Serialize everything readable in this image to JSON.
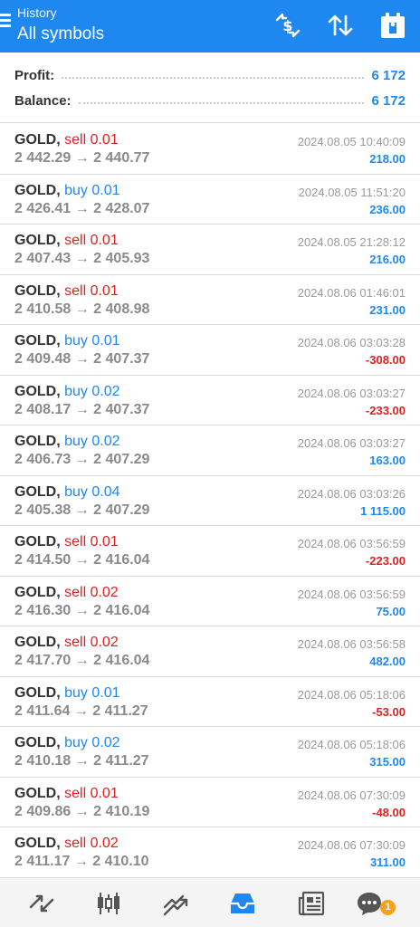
{
  "header": {
    "subtitle": "History",
    "title": "All symbols",
    "bg_color": "#1e88f0"
  },
  "summary": {
    "profit_label": "Profit:",
    "profit_value": "6 172",
    "balance_label": "Balance:",
    "balance_value": "6 172"
  },
  "deals": [
    {
      "symbol": "GOLD,",
      "type": "sell 0.01",
      "side": "sell",
      "prices": "2 442.29 → 2 440.77",
      "time": "2024.08.05 10:40:09",
      "profit": "218.00",
      "sign": "pos"
    },
    {
      "symbol": "GOLD,",
      "type": "buy 0.01",
      "side": "buy",
      "prices": "2 426.41 → 2 428.07",
      "time": "2024.08.05 11:51:20",
      "profit": "236.00",
      "sign": "pos"
    },
    {
      "symbol": "GOLD,",
      "type": "sell 0.01",
      "side": "sell",
      "prices": "2 407.43 → 2 405.93",
      "time": "2024.08.05 21:28:12",
      "profit": "216.00",
      "sign": "pos"
    },
    {
      "symbol": "GOLD,",
      "type": "sell 0.01",
      "side": "sell",
      "prices": "2 410.58 → 2 408.98",
      "time": "2024.08.06 01:46:01",
      "profit": "231.00",
      "sign": "pos"
    },
    {
      "symbol": "GOLD,",
      "type": "buy 0.01",
      "side": "buy",
      "prices": "2 409.48 → 2 407.37",
      "time": "2024.08.06 03:03:28",
      "profit": "-308.00",
      "sign": "neg"
    },
    {
      "symbol": "GOLD,",
      "type": "buy 0.02",
      "side": "buy",
      "prices": "2 408.17 → 2 407.37",
      "time": "2024.08.06 03:03:27",
      "profit": "-233.00",
      "sign": "neg"
    },
    {
      "symbol": "GOLD,",
      "type": "buy 0.02",
      "side": "buy",
      "prices": "2 406.73 → 2 407.29",
      "time": "2024.08.06 03:03:27",
      "profit": "163.00",
      "sign": "pos"
    },
    {
      "symbol": "GOLD,",
      "type": "buy 0.04",
      "side": "buy",
      "prices": "2 405.38 → 2 407.29",
      "time": "2024.08.06 03:03:26",
      "profit": "1 115.00",
      "sign": "pos"
    },
    {
      "symbol": "GOLD,",
      "type": "sell 0.01",
      "side": "sell",
      "prices": "2 414.50 → 2 416.04",
      "time": "2024.08.06 03:56:59",
      "profit": "-223.00",
      "sign": "neg"
    },
    {
      "symbol": "GOLD,",
      "type": "sell 0.02",
      "side": "sell",
      "prices": "2 416.30 → 2 416.04",
      "time": "2024.08.06 03:56:59",
      "profit": "75.00",
      "sign": "pos"
    },
    {
      "symbol": "GOLD,",
      "type": "sell 0.02",
      "side": "sell",
      "prices": "2 417.70 → 2 416.04",
      "time": "2024.08.06 03:56:58",
      "profit": "482.00",
      "sign": "pos"
    },
    {
      "symbol": "GOLD,",
      "type": "buy 0.01",
      "side": "buy",
      "prices": "2 411.64 → 2 411.27",
      "time": "2024.08.06 05:18:06",
      "profit": "-53.00",
      "sign": "neg"
    },
    {
      "symbol": "GOLD,",
      "type": "buy 0.02",
      "side": "buy",
      "prices": "2 410.18 → 2 411.27",
      "time": "2024.08.06 05:18:06",
      "profit": "315.00",
      "sign": "pos"
    },
    {
      "symbol": "GOLD,",
      "type": "sell 0.01",
      "side": "sell",
      "prices": "2 409.86 → 2 410.19",
      "time": "2024.08.06 07:30:09",
      "profit": "-48.00",
      "sign": "neg"
    },
    {
      "symbol": "GOLD,",
      "type": "sell 0.02",
      "side": "sell",
      "prices": "2 411.17 → 2 410.10",
      "time": "2024.08.06 07:30:09",
      "profit": "311.00",
      "sign": "pos"
    }
  ],
  "bottom_nav": {
    "items": [
      "quotes-icon",
      "chart-icon",
      "trade-icon",
      "history-icon",
      "news-icon",
      "messages-icon"
    ],
    "active": "history-icon",
    "badge": "1"
  },
  "colors": {
    "accent": "#1e88f0",
    "loss": "#e02020",
    "badge": "#f5a21b"
  }
}
